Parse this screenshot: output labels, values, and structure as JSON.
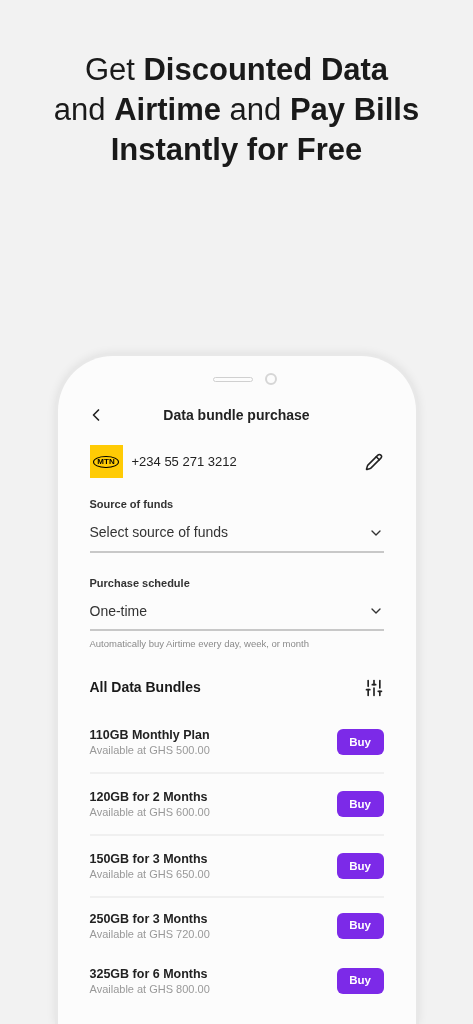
{
  "headline": "Get **Discounted Data**\nand **Airtime** and **Pay Bills**\n**Instantly for Free**",
  "screen": {
    "title": "Data bundle purchase",
    "carrier": {
      "logo": "MTN",
      "phone": "+234 55 271 3212"
    },
    "fields": [
      {
        "label": "Source of funds",
        "value": "Select source of funds"
      },
      {
        "label": "Purchase schedule",
        "value": "One-time",
        "hint": "Automatically buy Airtime every day, week, or month"
      }
    ],
    "section_title": "All Data Bundles",
    "bundles": [
      {
        "name": "110GB Monthly Plan",
        "price": "Available at GHS 500.00",
        "button": "Buy",
        "divider_below": true
      },
      {
        "name": "120GB for 2 Months",
        "price": "Available at GHS 600.00",
        "button": "Buy",
        "divider_below": true
      },
      {
        "name": "150GB for 3 Months",
        "price": "Available at GHS 650.00",
        "button": "Buy",
        "divider_below": true
      },
      {
        "name": "250GB for 3 Months",
        "price": "Available at GHS 720.00",
        "button": "Buy",
        "divider_below": false
      },
      {
        "name": "325GB for 6 Months",
        "price": "Available at GHS 800.00",
        "button": "Buy",
        "divider_below": false
      }
    ]
  }
}
